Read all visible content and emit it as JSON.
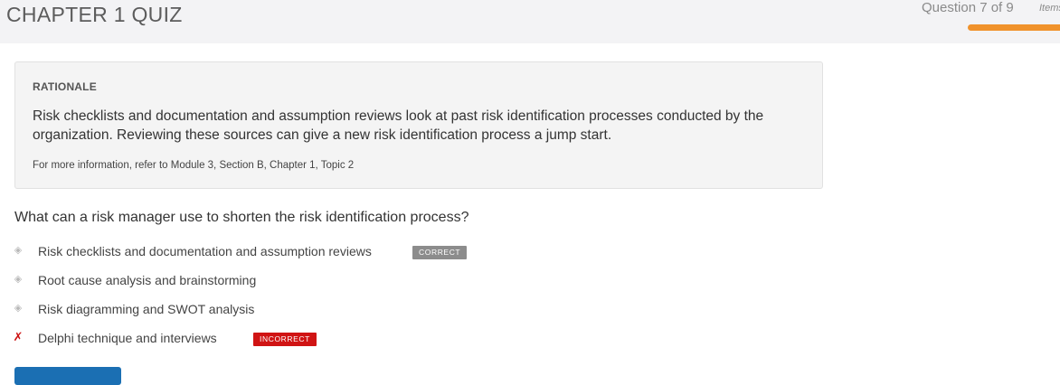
{
  "header": {
    "quiz_title": "CHAPTER 1 QUIZ",
    "progress_label": "Question 7 of 9",
    "items_label": "Items",
    "progress_fraction": 0.78,
    "progress_color": "#f0922b"
  },
  "rationale": {
    "heading": "RATIONALE",
    "text": "Risk checklists and documentation and assumption reviews look at past risk identification processes conducted by the organization. Reviewing these sources can give a new risk identification process a jump start.",
    "reference": "For more information, refer to Module 3, Section B, Chapter 1, Topic 2"
  },
  "question": {
    "text": "What can a risk manager use to shorten the risk identification process?"
  },
  "answers": [
    {
      "text": "Risk checklists and documentation and assumption reviews",
      "marker": "diamond-icon",
      "badge": "CORRECT",
      "badge_color": "#8c8c8c"
    },
    {
      "text": "Root cause analysis and brainstorming",
      "marker": "diamond-icon"
    },
    {
      "text": "Risk diagramming and SWOT analysis",
      "marker": "diamond-icon"
    },
    {
      "text": "Delphi technique and interviews",
      "marker": "x-icon",
      "badge": "INCORRECT",
      "badge_color": "#d01414"
    }
  ],
  "colors": {
    "accent": "#1b6fb3",
    "correct": "#8c8c8c",
    "incorrect": "#d01414"
  }
}
